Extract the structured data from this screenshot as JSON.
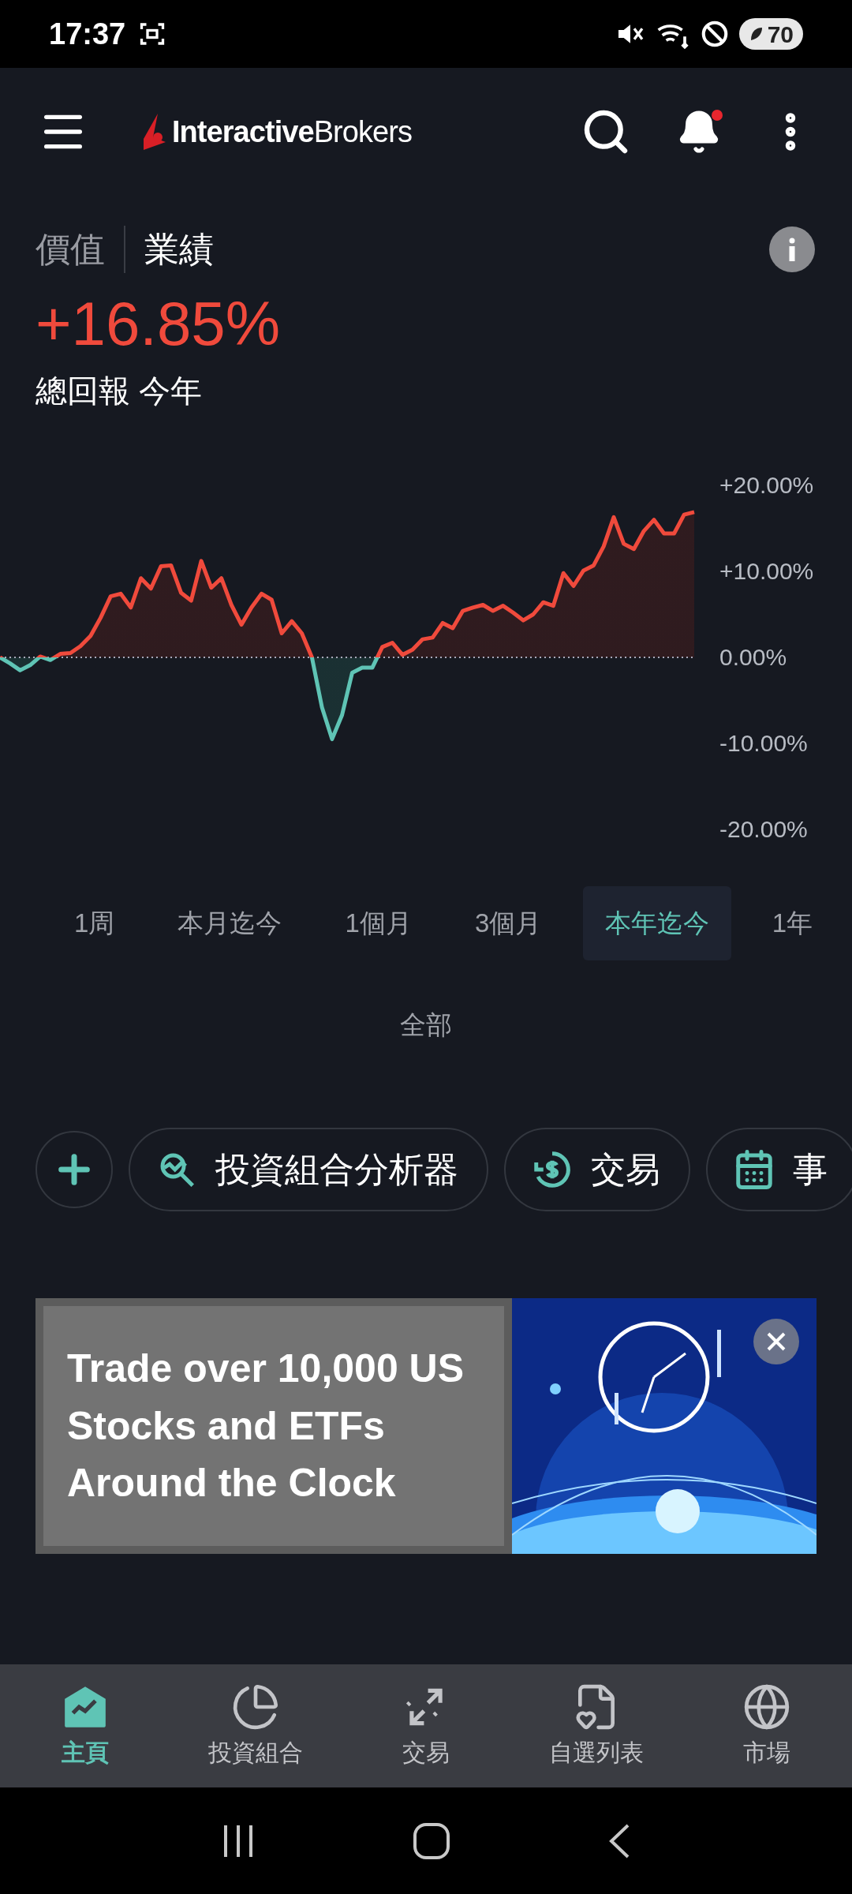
{
  "status_bar": {
    "time": "17:37",
    "battery": "70"
  },
  "header": {
    "logo": "**Interactive**Brokers",
    "notification_dot": true
  },
  "view_tabs": [
    {
      "label": "價值",
      "selected": false
    },
    {
      "label": "業績",
      "selected": true
    }
  ],
  "performance": {
    "value": "+16.85%",
    "caption": "總回報 今年"
  },
  "chart": {
    "chart_data": {
      "type": "area",
      "ylim": [
        -20,
        20
      ],
      "yticks": [
        {
          "value": 20,
          "label": "+20.00%"
        },
        {
          "value": 10,
          "label": "+10.00%"
        },
        {
          "value": 0,
          "label": "0.00%"
        },
        {
          "value": -10,
          "label": "-10.00%"
        },
        {
          "value": -20,
          "label": "-20.00%"
        }
      ],
      "series": [
        {
          "color": "#f04a3c",
          "values": [
            0,
            -0.7,
            -1.5,
            -0.9,
            0.1,
            -0.3,
            0.4,
            0.5,
            1.3,
            2.5,
            4.6,
            7.1,
            7.4,
            5.8,
            9.2,
            8,
            10.6,
            10.7,
            7.5,
            6.6,
            11.2,
            8.1,
            9.2,
            6.1,
            3.8,
            5.8,
            7.4,
            6.7,
            2.8,
            4.2,
            2.8,
            0,
            -5.8,
            -9.5,
            -6.7,
            -1.8,
            -1.2,
            -1.2,
            1.2,
            1.7,
            0.3,
            0.9,
            2.1,
            2.3,
            4,
            3.4,
            5.4,
            5.8,
            6.1,
            5.4,
            6,
            5.2,
            4.3,
            5,
            6.4,
            6,
            9.8,
            8.3,
            10.1,
            10.7,
            12.9,
            16.3,
            13.2,
            12.6,
            14.7,
            16,
            14.4,
            14.4,
            16.6,
            16.9
          ]
        }
      ]
    }
  },
  "ranges": [
    {
      "label": "1周",
      "selected": false
    },
    {
      "label": "本月迄今",
      "selected": false
    },
    {
      "label": "1個月",
      "selected": false
    },
    {
      "label": "3個月",
      "selected": false
    },
    {
      "label": "本年迄今",
      "selected": true
    },
    {
      "label": "1年",
      "selected": false
    }
  ],
  "all_range": {
    "label": "全部",
    "selected": false
  },
  "shortcuts": [
    {
      "label": "投資組合分析器"
    },
    {
      "label": "交易"
    },
    {
      "label": "事"
    }
  ],
  "banner": {
    "headline": "Trade over 10,000 US Stocks and ETFs Around the Clock"
  },
  "bottom_nav": [
    {
      "label": "主頁",
      "selected": true
    },
    {
      "label": "投資組合",
      "selected": false
    },
    {
      "label": "交易",
      "selected": false
    },
    {
      "label": "自選列表",
      "selected": false
    },
    {
      "label": "市場",
      "selected": false
    }
  ]
}
